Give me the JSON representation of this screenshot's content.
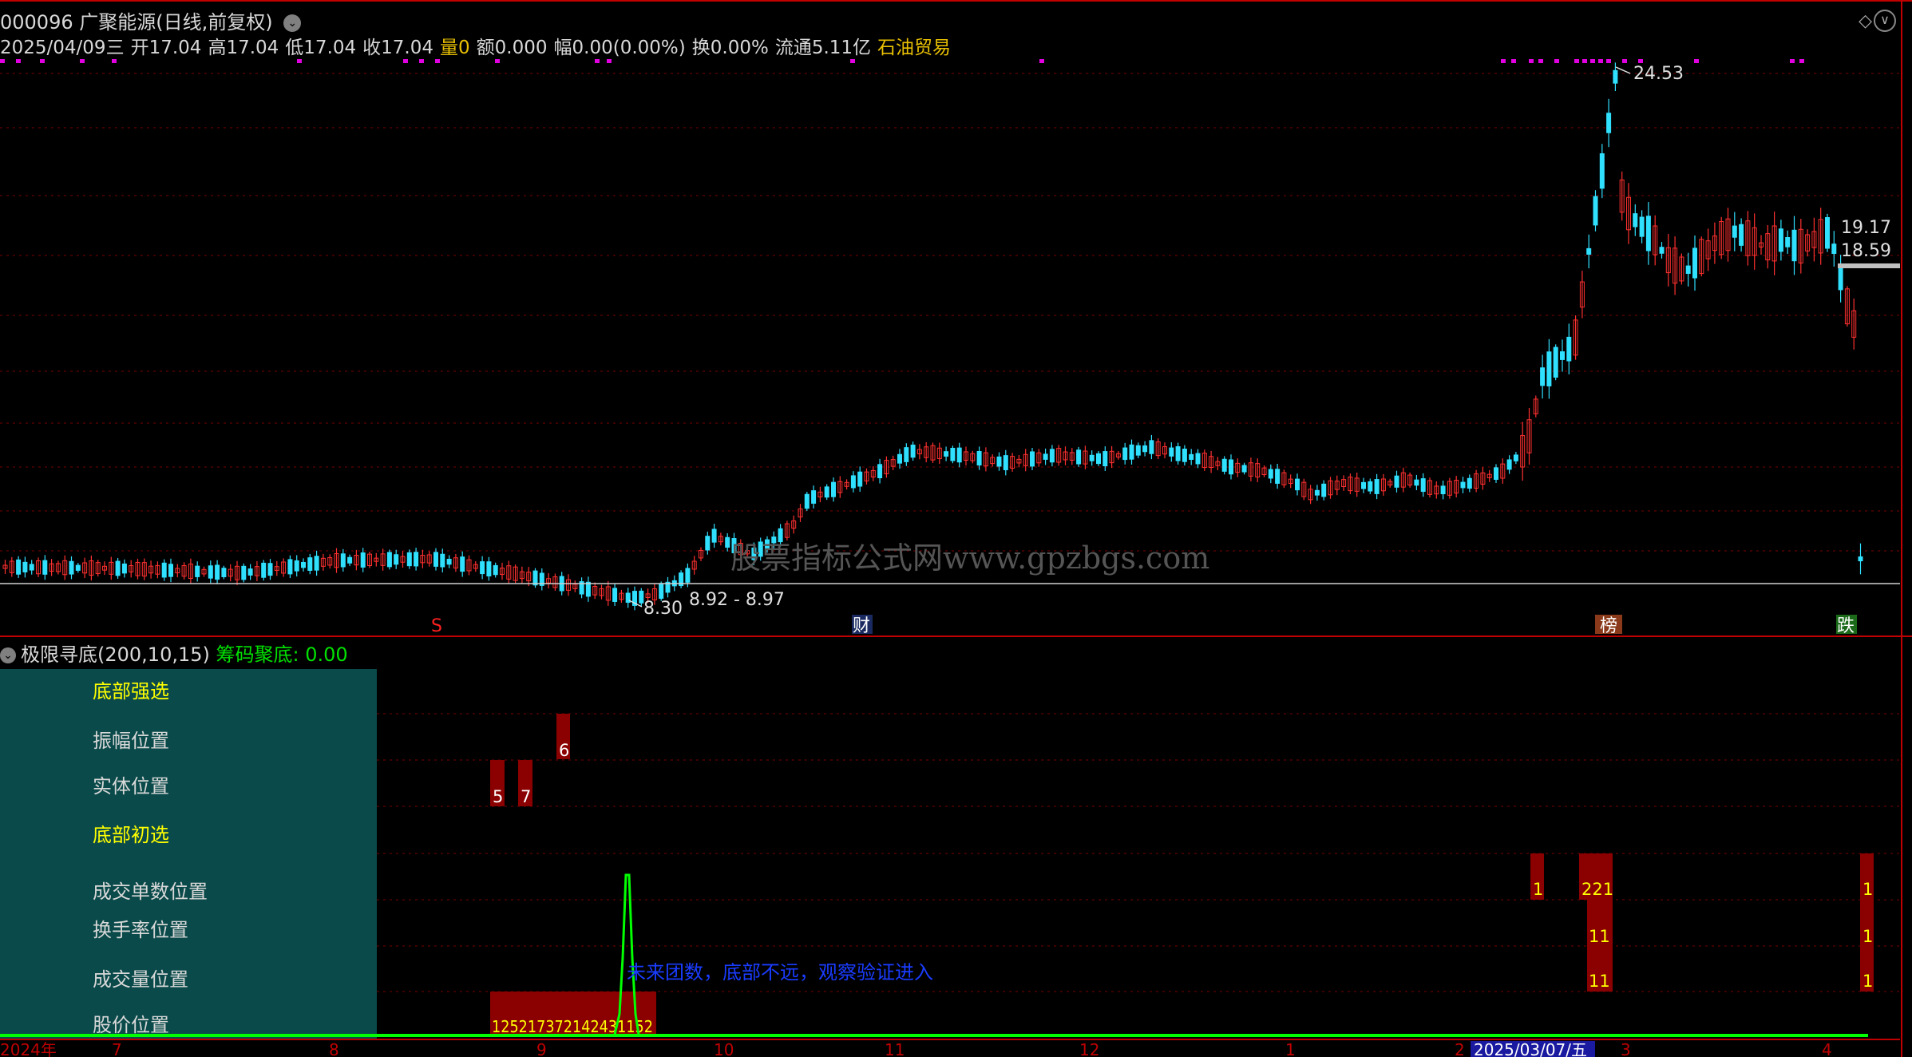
{
  "header": {
    "code_name": "000096 广聚能源(日线,前复权)",
    "date": "2025/04/09三",
    "open": "开17.04",
    "high": "高17.04",
    "low": "低17.04",
    "close": "收17.04",
    "volume": "量0",
    "amount": "额0.000",
    "amplitude": "幅0.00(0.00%)",
    "turnover": "换0.00%",
    "float_cap": "流通5.11亿",
    "sector": "石油贸易",
    "collapse_icon": "chevron-down-icon"
  },
  "main_chart": {
    "labels": {
      "high_label": "24.53",
      "low_label": "8.30",
      "range_label": "8.92 - 8.97",
      "right_label_1": "19.17",
      "right_label_2": "18.59"
    },
    "markers": {
      "s_marker": "S",
      "cai_marker": "财",
      "bang_marker": "榜",
      "die_marker": "跌"
    },
    "watermark": "股票指标公式网www.gpzbgs.com",
    "colors": {
      "up": "#ff3030",
      "down": "#30e0ff",
      "flat": "#ffffff",
      "marker": "#e000e0"
    }
  },
  "indicator": {
    "title": "极限寻底(200,10,15)",
    "value_label": "筹码聚底: 0.00",
    "rows": [
      {
        "label": "底部强选",
        "highlight": true
      },
      {
        "label": "振幅位置",
        "highlight": false
      },
      {
        "label": "实体位置",
        "highlight": false
      },
      {
        "label": "底部初选",
        "highlight": true
      },
      {
        "label": "成交单数位置",
        "highlight": false
      },
      {
        "label": "换手率位置",
        "highlight": false
      },
      {
        "label": "成交量位置",
        "highlight": false
      },
      {
        "label": "股价位置",
        "highlight": false
      }
    ],
    "values": {
      "amp_6": "6",
      "body_5": "5",
      "body_7": "7",
      "count_1a": "1",
      "count_221": "221",
      "count_1b": "1",
      "turn_11": "11",
      "turn_1": "1",
      "vol_11": "11",
      "vol_1": "1",
      "price_seq": "125217372142431152"
    },
    "note": "未来团数，底部不远，观察验证进入"
  },
  "axis": {
    "date_highlight": "2025/03/07/五",
    "year_label": "2024年",
    "ticks": [
      "7",
      "8",
      "9",
      "10",
      "11",
      "12",
      "1",
      "2",
      "3",
      "4"
    ]
  }
}
